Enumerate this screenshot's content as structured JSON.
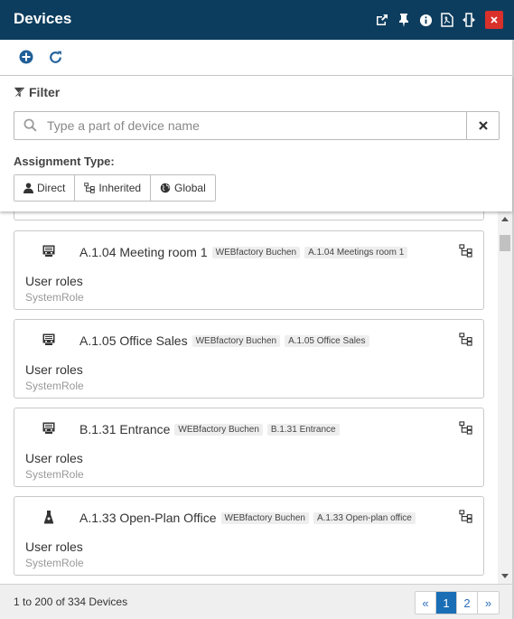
{
  "window": {
    "title": "Devices",
    "title_icons": [
      "popout-icon",
      "pin-icon",
      "info-icon",
      "pdf-icon",
      "resize-icon",
      "close-icon"
    ],
    "close_color": "#d9302b",
    "title_bg": "#0d3d5e"
  },
  "toolbar": {
    "add_icon": "add-circle-icon",
    "refresh_icon": "refresh-icon"
  },
  "filter": {
    "label": "Filter",
    "search_placeholder": "Type a part of device name",
    "search_value": "",
    "assignment_label": "Assignment Type:",
    "assignment_options": [
      {
        "label": "Direct",
        "icon": "user-icon"
      },
      {
        "label": "Inherited",
        "icon": "hierarchy-icon"
      },
      {
        "label": "Global",
        "icon": "globe-icon"
      }
    ]
  },
  "devices": [
    {
      "name": "A.1.04 Meeting room 1",
      "tags": [
        "WEBfactory Buchen",
        "A.1.04 Meetings room 1"
      ],
      "role_label": "User roles",
      "role_type": "SystemRole",
      "icon": "device-panel-icon"
    },
    {
      "name": "A.1.05 Office Sales",
      "tags": [
        "WEBfactory Buchen",
        "A.1.05 Office Sales"
      ],
      "role_label": "User roles",
      "role_type": "SystemRole",
      "icon": "device-panel-icon"
    },
    {
      "name": "B.1.31 Entrance",
      "tags": [
        "WEBfactory Buchen",
        "B.1.31 Entrance"
      ],
      "role_label": "User roles",
      "role_type": "SystemRole",
      "icon": "device-panel-icon"
    },
    {
      "name": "A.1.33 Open-Plan Office",
      "tags": [
        "WEBfactory Buchen",
        "A.1.33 Open-plan office"
      ],
      "role_label": "User roles",
      "role_type": "SystemRole",
      "icon": "device-lamp-icon"
    }
  ],
  "footer": {
    "count_text": "1 to 200 of 334 Devices",
    "pager": {
      "prev": "«",
      "pages": [
        "1",
        "2"
      ],
      "active": "1",
      "next": "»"
    }
  },
  "colors": {
    "accent": "#1a6eb5",
    "primary_icon": "#1f5f99"
  }
}
